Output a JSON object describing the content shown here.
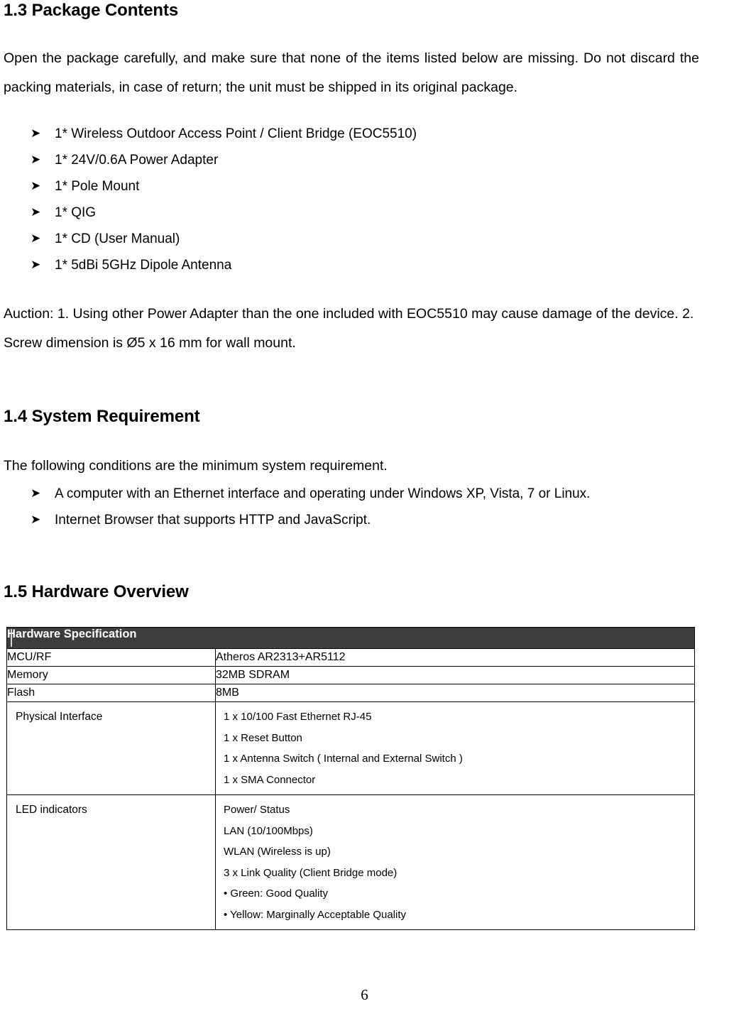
{
  "sections": {
    "package_contents": {
      "heading": "1.3 Package Contents",
      "intro": "Open the package carefully, and make sure that none of the items listed below are missing. Do not discard the packing materials, in case of return; the unit must be shipped in its original package.",
      "bullet_glyph": "➤",
      "items": [
        "1* Wireless Outdoor Access Point / Client Bridge (EOC5510)",
        "1* 24V/0.6A Power Adapter",
        "1* Pole Mount",
        "1* QIG",
        "1* CD (User Manual)",
        "1* 5dBi 5GHz Dipole Antenna"
      ],
      "auction_note": "Auction: 1. Using other Power Adapter than the one included with EOC5510 may cause damage of the device. 2. Screw dimension is Ø5 x 16 mm for wall mount."
    },
    "system_requirement": {
      "heading": "1.4 System Requirement",
      "intro": "The following conditions are the minimum system requirement.",
      "items": [
        "A computer with an Ethernet interface and operating under Windows XP, Vista, 7 or Linux.",
        "Internet Browser that supports HTTP and JavaScript."
      ]
    },
    "hardware_overview": {
      "heading": "1.5 Hardware Overview",
      "table": {
        "header": "Hardware Specification",
        "header_bg": "#3d3d3d",
        "header_color": "#ffffff",
        "rows": [
          {
            "key": "MCU/RF",
            "value_lines": [
              "Atheros AR2313+AR5112"
            ]
          },
          {
            "key": "Memory",
            "value_lines": [
              "32MB SDRAM"
            ]
          },
          {
            "key": "Flash",
            "value_lines": [
              "8MB"
            ]
          },
          {
            "key": "Physical Interface",
            "value_lines": [
              "1 x 10/100 Fast Ethernet RJ-45",
              "1 x Reset Button",
              "1 x Antenna Switch ( Internal and External Switch )",
              "1 x SMA Connector"
            ]
          },
          {
            "key": "LED indicators",
            "value_lines": [
              "Power/ Status",
              "LAN (10/100Mbps)",
              "WLAN (Wireless is up)",
              "3 x Link Quality (Client Bridge mode)",
              "• Green: Good Quality",
              "• Yellow: Marginally Acceptable Quality"
            ]
          }
        ]
      }
    }
  },
  "footer": {
    "page_number": "6"
  }
}
